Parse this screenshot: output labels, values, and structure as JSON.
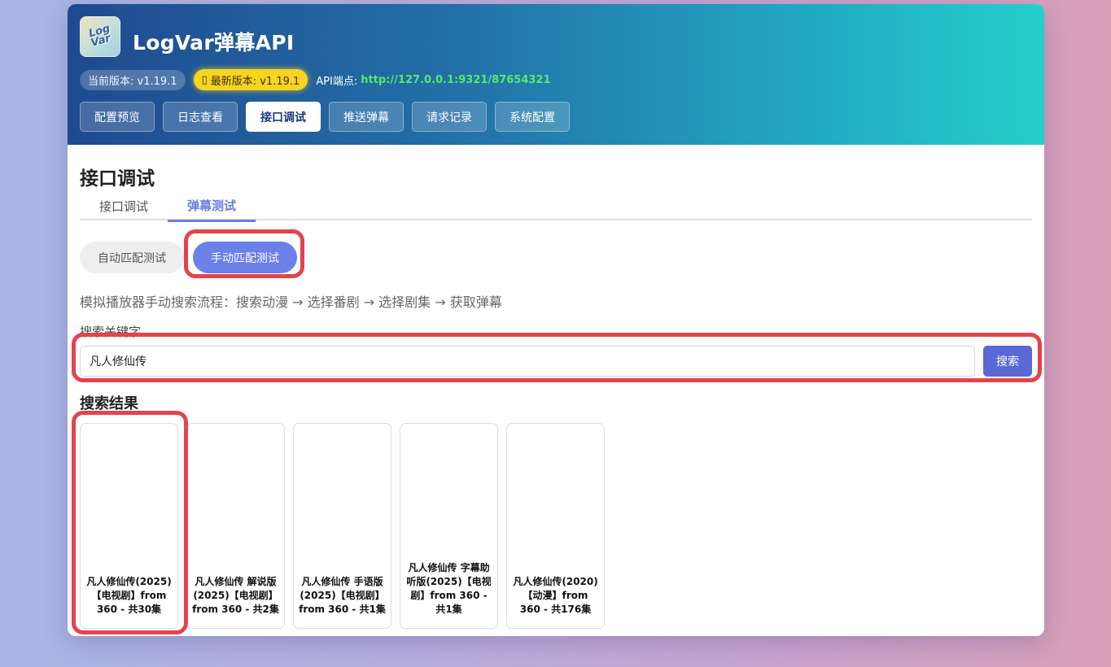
{
  "app": {
    "title": "LogVar弹幕API",
    "logo_line1": "Log",
    "logo_line2": "Var"
  },
  "meta": {
    "current_version": "当前版本: v1.19.1",
    "latest_icon": "▯",
    "latest_version": "最新版本: v1.19.1",
    "api_label": "API端点:",
    "api_url": "http://127.0.0.1:9321/87654321"
  },
  "nav": {
    "items": [
      {
        "label": "配置预览"
      },
      {
        "label": "日志查看"
      },
      {
        "label": "接口调试"
      },
      {
        "label": "推送弹幕"
      },
      {
        "label": "请求记录"
      },
      {
        "label": "系统配置"
      }
    ],
    "active": "接口调试"
  },
  "section": {
    "title": "接口调试",
    "subtabs": [
      "接口调试",
      "弹幕测试"
    ],
    "active_subtab": "弹幕测试"
  },
  "modes": {
    "auto_label": "自动匹配测试",
    "manual_label": "手动匹配测试"
  },
  "description": "模拟播放器手动搜索流程：搜索动漫 → 选择番剧 → 选择剧集 → 获取弹幕",
  "search": {
    "label": "搜索关键字",
    "value": "凡人修仙传",
    "button": "搜索"
  },
  "results": {
    "title": "搜索结果",
    "items": [
      {
        "title": "凡人修仙传(2025)【电视剧】from 360 - 共30集"
      },
      {
        "title": "凡人修仙传 解说版(2025)【电视剧】from 360 - 共2集"
      },
      {
        "title": "凡人修仙传 手语版(2025)【电视剧】from 360 - 共1集"
      },
      {
        "title": "凡人修仙传 字幕助听版(2025)【电视剧】from 360 - 共1集"
      },
      {
        "title": "凡人修仙传(2020)【动漫】from 360 - 共176集"
      }
    ]
  },
  "colors": {
    "accent": "#6b80e8",
    "search_button": "#5a69d6",
    "highlight": "#e5434b",
    "api_url": "#59e86b",
    "badge_new": "#f6d41f"
  }
}
